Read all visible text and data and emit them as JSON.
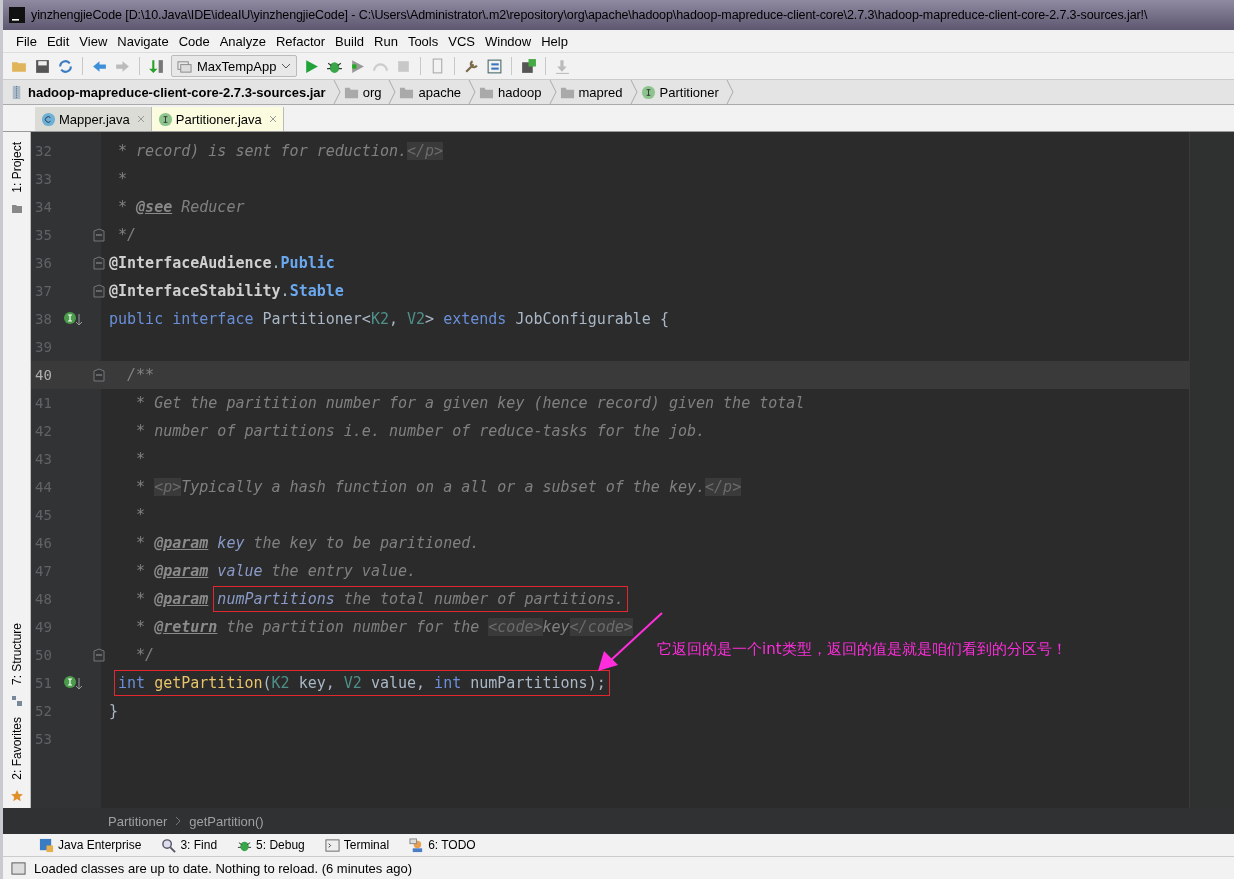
{
  "window": {
    "title": "yinzhengjieCode [D:\\10.Java\\IDE\\ideaIU\\yinzhengjieCode] - C:\\Users\\Administrator\\.m2\\repository\\org\\apache\\hadoop\\hadoop-mapreduce-client-core\\2.7.3\\hadoop-mapreduce-client-core-2.7.3-sources.jar!\\"
  },
  "menu": [
    "File",
    "Edit",
    "View",
    "Navigate",
    "Code",
    "Analyze",
    "Refactor",
    "Build",
    "Run",
    "Tools",
    "VCS",
    "Window",
    "Help"
  ],
  "toolbar": {
    "run_config": "MaxTempApp"
  },
  "nav_bar": [
    {
      "kind": "jar",
      "label": "hadoop-mapreduce-client-core-2.7.3-sources.jar"
    },
    {
      "kind": "folder",
      "label": "org"
    },
    {
      "kind": "folder",
      "label": "apache"
    },
    {
      "kind": "folder",
      "label": "hadoop"
    },
    {
      "kind": "folder",
      "label": "mapred"
    },
    {
      "kind": "interface",
      "label": "Partitioner"
    }
  ],
  "tabs": [
    {
      "kind": "class",
      "label": "Mapper.java",
      "selected": false
    },
    {
      "kind": "interface",
      "label": "Partitioner.java",
      "selected": true
    }
  ],
  "side_tabs": {
    "top": [
      "1: Project"
    ],
    "bottom": [
      "7: Structure",
      "2: Favorites"
    ]
  },
  "editor": {
    "lines": [
      {
        "number": "32",
        "fold": false,
        "current": false,
        "implemented": false,
        "segments": [
          {
            "kind": "text",
            "tokens": [
              {
                "kind": "comment",
                "text": " * record) is sent for reduction."
              },
              {
                "kind": "tag",
                "text": "</p>"
              }
            ]
          }
        ]
      },
      {
        "number": "33",
        "fold": false,
        "current": false,
        "implemented": false,
        "segments": [
          {
            "kind": "text",
            "tokens": [
              {
                "kind": "comment",
                "text": " *"
              }
            ]
          }
        ]
      },
      {
        "number": "34",
        "fold": false,
        "current": false,
        "implemented": false,
        "segments": [
          {
            "kind": "text",
            "tokens": [
              {
                "kind": "comment",
                "text": " * "
              },
              {
                "kind": "doctag",
                "text": "@see"
              },
              {
                "kind": "comment",
                "text": " Reducer"
              }
            ]
          }
        ]
      },
      {
        "number": "35",
        "fold": true,
        "current": false,
        "implemented": false,
        "segments": [
          {
            "kind": "text",
            "tokens": [
              {
                "kind": "comment",
                "text": " */"
              }
            ]
          }
        ]
      },
      {
        "number": "36",
        "fold": true,
        "current": false,
        "implemented": false,
        "segments": [
          {
            "kind": "text",
            "tokens": [
              {
                "kind": "annotation",
                "text": "@InterfaceAudience"
              },
              {
                "kind": "plain",
                "text": "."
              },
              {
                "kind": "constant",
                "text": "Public"
              }
            ]
          }
        ]
      },
      {
        "number": "37",
        "fold": true,
        "current": false,
        "implemented": false,
        "segments": [
          {
            "kind": "text",
            "tokens": [
              {
                "kind": "annotation",
                "text": "@InterfaceStability"
              },
              {
                "kind": "plain",
                "text": "."
              },
              {
                "kind": "constant",
                "text": "Stable"
              }
            ]
          }
        ]
      },
      {
        "number": "38",
        "fold": false,
        "current": false,
        "implemented": true,
        "segments": [
          {
            "kind": "text",
            "tokens": [
              {
                "kind": "keyword",
                "text": "public "
              },
              {
                "kind": "keyword",
                "text": "interface"
              },
              {
                "kind": "plain",
                "text": " Partitioner<"
              },
              {
                "kind": "typeparam",
                "text": "K2"
              },
              {
                "kind": "plain",
                "text": ", "
              },
              {
                "kind": "typeparam",
                "text": "V2"
              },
              {
                "kind": "plain",
                "text": "> "
              },
              {
                "kind": "keyword",
                "text": "extends"
              },
              {
                "kind": "plain",
                "text": " JobConfigurable {"
              }
            ]
          }
        ]
      },
      {
        "number": "39",
        "fold": false,
        "current": false,
        "implemented": false
      },
      {
        "number": "40",
        "fold": true,
        "current": true,
        "implemented": false,
        "segments": [
          {
            "kind": "text",
            "tokens": [
              {
                "kind": "comment",
                "text": "  /**"
              }
            ]
          }
        ]
      },
      {
        "number": "41",
        "fold": false,
        "current": false,
        "implemented": false,
        "segments": [
          {
            "kind": "text",
            "tokens": [
              {
                "kind": "comment",
                "text": "   * Get the paritition number for a given key (hence record) given the total"
              }
            ]
          }
        ]
      },
      {
        "number": "42",
        "fold": false,
        "current": false,
        "implemented": false,
        "segments": [
          {
            "kind": "text",
            "tokens": [
              {
                "kind": "comment",
                "text": "   * number of partitions i.e. number of reduce-tasks for the job."
              }
            ]
          }
        ]
      },
      {
        "number": "43",
        "fold": false,
        "current": false,
        "implemented": false,
        "segments": [
          {
            "kind": "text",
            "tokens": [
              {
                "kind": "comment",
                "text": "   *"
              }
            ]
          }
        ]
      },
      {
        "number": "44",
        "fold": false,
        "current": false,
        "implemented": false,
        "segments": [
          {
            "kind": "text",
            "tokens": [
              {
                "kind": "comment",
                "text": "   * "
              },
              {
                "kind": "tag",
                "text": "<p>"
              },
              {
                "kind": "comment",
                "text": "Typically a hash function on a all or a subset of the key."
              },
              {
                "kind": "tag",
                "text": "</p>"
              }
            ]
          }
        ]
      },
      {
        "number": "45",
        "fold": false,
        "current": false,
        "implemented": false,
        "segments": [
          {
            "kind": "text",
            "tokens": [
              {
                "kind": "comment",
                "text": "   *"
              }
            ]
          }
        ]
      },
      {
        "number": "46",
        "fold": false,
        "current": false,
        "implemented": false,
        "segments": [
          {
            "kind": "text",
            "tokens": [
              {
                "kind": "comment",
                "text": "   * "
              },
              {
                "kind": "doctag",
                "text": "@param"
              },
              {
                "kind": "paramname",
                "text": " key"
              },
              {
                "kind": "comment",
                "text": " the key to be paritioned."
              }
            ]
          }
        ]
      },
      {
        "number": "47",
        "fold": false,
        "current": false,
        "implemented": false,
        "segments": [
          {
            "kind": "text",
            "tokens": [
              {
                "kind": "comment",
                "text": "   * "
              },
              {
                "kind": "doctag",
                "text": "@param"
              },
              {
                "kind": "paramname",
                "text": " value"
              },
              {
                "kind": "comment",
                "text": " the entry value."
              }
            ]
          }
        ]
      },
      {
        "number": "48",
        "fold": false,
        "current": false,
        "implemented": false,
        "segments": [
          {
            "kind": "text",
            "tokens": [
              {
                "kind": "comment",
                "text": "   * "
              },
              {
                "kind": "doctag",
                "text": "@param"
              }
            ]
          },
          {
            "kind": "box",
            "tokens": [
              {
                "kind": "paramname",
                "text": "numPartitions"
              },
              {
                "kind": "comment",
                "text": " the total number of partitions."
              }
            ]
          }
        ]
      },
      {
        "number": "49",
        "fold": false,
        "current": false,
        "implemented": false,
        "segments": [
          {
            "kind": "text",
            "tokens": [
              {
                "kind": "comment",
                "text": "   * "
              },
              {
                "kind": "doctag",
                "text": "@return"
              },
              {
                "kind": "comment",
                "text": " the partition number for the "
              },
              {
                "kind": "tag",
                "text": "<code>"
              },
              {
                "kind": "comment",
                "text": "key"
              },
              {
                "kind": "tag",
                "text": "</code>"
              }
            ]
          }
        ]
      },
      {
        "number": "50",
        "fold": true,
        "current": false,
        "implemented": false,
        "segments": [
          {
            "kind": "text",
            "tokens": [
              {
                "kind": "comment",
                "text": "   */"
              }
            ]
          }
        ]
      },
      {
        "number": "51",
        "fold": false,
        "current": false,
        "implemented": true,
        "segments": [
          {
            "kind": "box",
            "tokens": [
              {
                "kind": "keyword",
                "text": "int"
              },
              {
                "kind": "method",
                "text": " getPartition"
              },
              {
                "kind": "plain",
                "text": "("
              },
              {
                "kind": "typeparam",
                "text": "K2"
              },
              {
                "kind": "plain",
                "text": " key, "
              },
              {
                "kind": "typeparam",
                "text": "V2"
              },
              {
                "kind": "plain",
                "text": " value, "
              },
              {
                "kind": "keyword",
                "text": "int"
              },
              {
                "kind": "plain",
                "text": " numPartitions);"
              }
            ]
          }
        ]
      },
      {
        "number": "52",
        "fold": false,
        "current": false,
        "implemented": false,
        "segments": [
          {
            "kind": "text",
            "tokens": [
              {
                "kind": "plain",
                "text": "}"
              }
            ]
          }
        ]
      },
      {
        "number": "53",
        "fold": false,
        "current": false,
        "implemented": false
      }
    ],
    "callout": "它返回的是一个int类型，返回的值是就是咱们看到的分区号！"
  },
  "breadcrumb": [
    "Partitioner",
    "getPartition()"
  ],
  "tool_windows": [
    {
      "kind": "javaee",
      "label": "Java Enterprise"
    },
    {
      "kind": "find",
      "label": "3: Find"
    },
    {
      "kind": "debug",
      "label": "5: Debug"
    },
    {
      "kind": "terminal",
      "label": "Terminal"
    },
    {
      "kind": "todo",
      "label": "6: TODO"
    }
  ],
  "status_bar": "Loaded classes are up to date. Nothing to reload. (6 minutes ago)"
}
